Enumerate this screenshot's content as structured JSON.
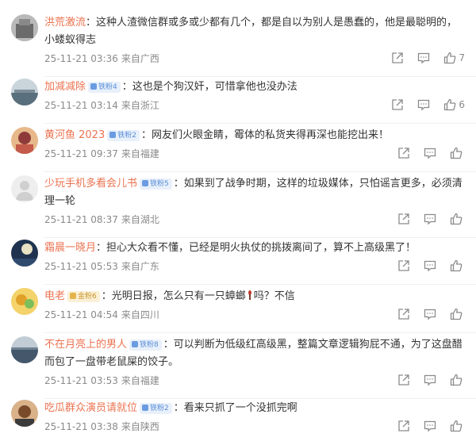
{
  "comments": [
    {
      "user": "洪荒激流",
      "badge": "",
      "text": "：这种人渣微信群或多或少都有几个，都是自以为别人是愚蠢的，他是最聪明的，小蝼蚁得志",
      "time": "25-11-21 03:36",
      "location": "来自广西",
      "likes": "7",
      "avatar_color": "#6b6b6b",
      "avatar_bg": "#a9a9a9"
    },
    {
      "user": "加减减除",
      "badge": "铁粉4",
      "text": "：这也是个狗汉奸，可惜拿他也没办法",
      "time": "25-11-21 03:14",
      "location": "来自浙江",
      "likes": "6",
      "avatar_color": "#5a6f7d",
      "avatar_bg": "#b7c4cc"
    },
    {
      "user": "黄河鱼 2023",
      "badge": "铁粉2",
      "text": "：网友们火眼金睛，霉体的私货夹得再深也能挖出来！",
      "time": "25-11-21 09:37",
      "location": "来自福建",
      "likes": "",
      "avatar_color": "#8f3a3a",
      "avatar_bg": "#d59a6c"
    },
    {
      "user": "少玩手机多看会儿书",
      "badge": "铁粉5",
      "text": "：如果到了战争时期，这样的垃圾媒体，只怕谣言更多，必须清理一轮",
      "time": "25-11-21 08:37",
      "location": "来自湖北",
      "likes": "",
      "avatar_color": "#d9d9d9",
      "avatar_bg": "#eeeeee"
    },
    {
      "user": "霜晨一晓月",
      "badge": "",
      "text": "：担心大众看不懂，已经是明火执仗的挑拨离间了，算不上高级黑了！",
      "time": "25-11-21 05:53",
      "location": "来自广东",
      "likes": "",
      "avatar_color": "#2f4a6e",
      "avatar_bg": "#7a93b5"
    },
    {
      "user": "电老",
      "badge": "金粉6",
      "text": "：光明日报，怎么只有一只蟑螂",
      "text2": "吗？不信",
      "time": "25-11-21 04:54",
      "location": "来自四川",
      "likes": "",
      "avatar_color": "#e0a12a",
      "avatar_bg": "#f4d36b"
    },
    {
      "user": "不在月亮上的男人",
      "badge": "铁粉8",
      "text": "：可以判断为低级红高级黑，整篇文章逻辑狗屁不通，为了这盘醋而包了一盘带老鼠屎的饺子。",
      "time": "25-11-21 03:53",
      "location": "来自福建",
      "likes": "",
      "avatar_color": "#44576b",
      "avatar_bg": "#9fb2c3"
    },
    {
      "user": "吃瓜群众演员请就位",
      "badge": "铁粉2",
      "text": "：看来只抓了一个没抓完啊",
      "time": "25-11-21 03:38",
      "location": "来自陕西",
      "likes": "",
      "avatar_color": "#7a4b2a",
      "avatar_bg": "#c98f5e"
    }
  ],
  "colors": {
    "username": "#eb7350",
    "meta": "#8a8a8a",
    "text": "#333333"
  },
  "icons": {
    "share": "share-icon",
    "comment": "comment-icon",
    "like": "thumb-up-icon"
  }
}
